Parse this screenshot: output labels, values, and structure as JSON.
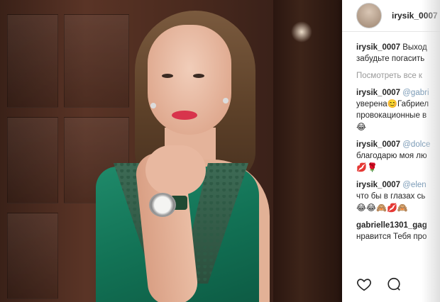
{
  "post": {
    "username": "irysik_0007",
    "caption_user": "irysik_0007",
    "caption_text": "Выход",
    "caption_line2": "забудьте погасить",
    "view_all": "Посмотреть все к"
  },
  "comments": [
    {
      "user": "irysik_0007",
      "mention": "@gabri",
      "line2": "уверена😊Габриел",
      "line3": "провокационные в",
      "line4": "😂"
    },
    {
      "user": "irysik_0007",
      "mention": "@dolce",
      "line2": "благодарю моя лю",
      "line3": "💋🌹"
    },
    {
      "user": "irysik_0007",
      "mention": "@elen",
      "line2": "что бы в глазах сь",
      "line3": "😂😂🙈💋🙈"
    },
    {
      "user": "gabrielle1301_gag",
      "mention": "",
      "line2": "нравится Тебя про"
    }
  ],
  "actions": {
    "like_icon": "heart-icon",
    "comment_icon": "comment-icon"
  },
  "colors": {
    "mention": "#7a9ab6",
    "muted": "#999999",
    "text": "#262626"
  }
}
